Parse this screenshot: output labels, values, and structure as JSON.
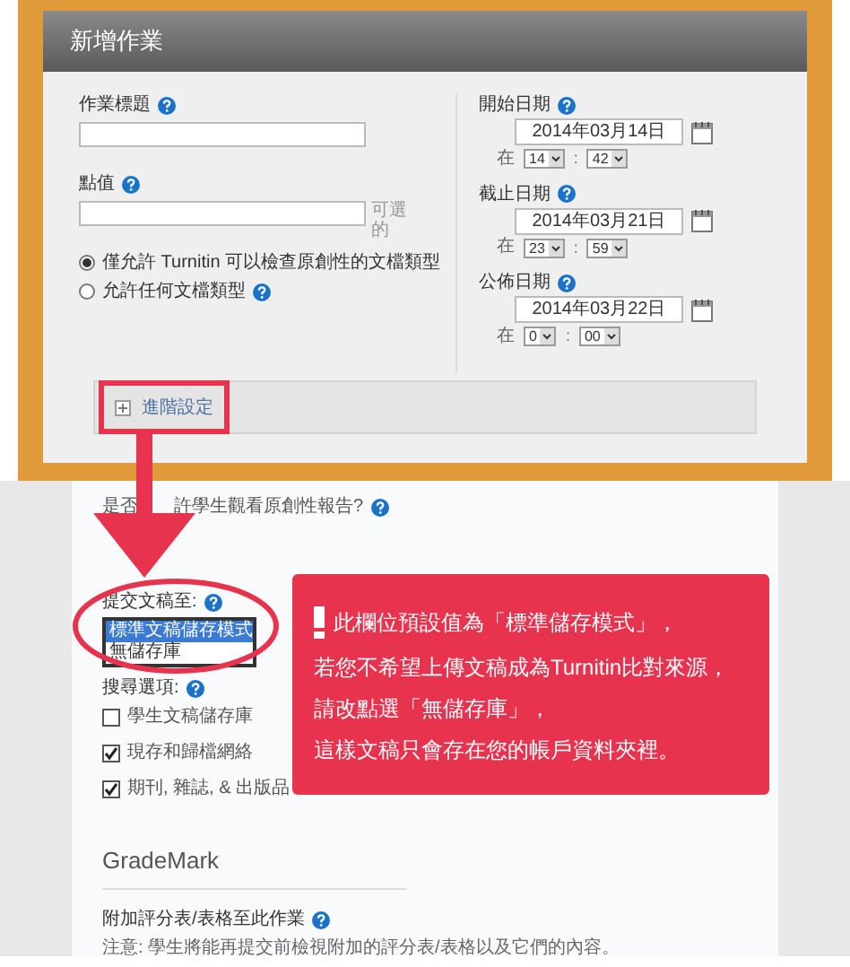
{
  "dialog": {
    "title": "新增作業"
  },
  "assignment_title": {
    "label": "作業標題"
  },
  "point_value": {
    "label": "點值",
    "hint": "可選的"
  },
  "file_type_options": [
    {
      "label": "僅允許 Turnitin 可以檢查原創性的文檔類型",
      "selected": true,
      "help": false
    },
    {
      "label": "允許任何文檔類型",
      "selected": false,
      "help": true
    }
  ],
  "dates": [
    {
      "label": "開始日期",
      "date": "2014年03月14日",
      "at": "在",
      "hour": "14",
      "separator": ":",
      "minute": "42"
    },
    {
      "label": "截止日期",
      "date": "2014年03月21日",
      "at": "在",
      "hour": "23",
      "separator": ":",
      "minute": "59"
    },
    {
      "label": "公佈日期",
      "date": "2014年03月22日",
      "at": "在",
      "hour": "0",
      "separator": ":",
      "minute": "00"
    }
  ],
  "advanced_settings": {
    "label": "進階設定",
    "expanded": false
  },
  "originality_report_question": {
    "visible_parts": [
      "是否",
      "許學生觀看原創性報告?"
    ]
  },
  "submit_papers_to": {
    "label": "提交文稿至:",
    "options": [
      {
        "label": "標準文稿儲存模式",
        "selected": true
      },
      {
        "label": "無儲存庫",
        "selected": false
      }
    ]
  },
  "search_options": {
    "label": "搜尋選項:",
    "items": [
      {
        "label": "學生文稿儲存庫",
        "checked": false
      },
      {
        "label": "現存和歸檔網絡",
        "checked": true
      },
      {
        "label": "期刊, 雜誌, & 出版品",
        "checked": true
      }
    ]
  },
  "grademark": {
    "heading": "GradeMark",
    "attach_label": "附加評分表/表格至此作業",
    "note": "注意: 學生將能再提交前檢視附加的評分表/表格以及它們的內容。"
  },
  "callout": {
    "lines": [
      "此欄位預設值為「標準儲存模式」，",
      "若您不希望上傳文稿成為Turnitin比對來源，",
      "請改點選「無儲存庫」，",
      "這樣文稿只會存在您的帳戶資料夾裡。"
    ]
  }
}
